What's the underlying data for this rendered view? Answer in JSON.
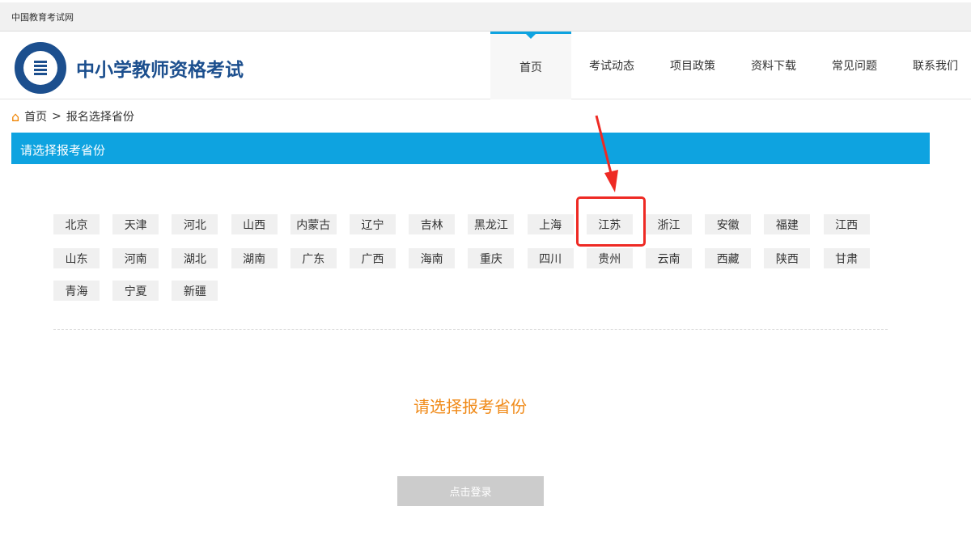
{
  "topbar": {
    "label": "中国教育考试网"
  },
  "header": {
    "title": "中小学教师资格考试",
    "nav": [
      "首页",
      "考试动态",
      "项目政策",
      "资料下载",
      "常见问题",
      "联系我们"
    ]
  },
  "breadcrumb": {
    "home": "首页",
    "sep": ">",
    "current": "报名选择省份"
  },
  "section": {
    "title": "请选择报考省份"
  },
  "provinces": [
    [
      "北京",
      "天津",
      "河北",
      "山西",
      "内蒙古",
      "辽宁",
      "吉林",
      "黑龙江",
      "上海",
      "江苏",
      "浙江",
      "安徽",
      "福建",
      "江西"
    ],
    [
      "山东",
      "河南",
      "湖北",
      "湖南",
      "广东",
      "广西",
      "海南",
      "重庆",
      "四川",
      "贵州",
      "云南",
      "西藏",
      "陕西",
      "甘肃"
    ],
    [
      "青海",
      "宁夏",
      "新疆"
    ]
  ],
  "highlighted": "江苏",
  "message": "请选择报考省份",
  "login_button": "点击登录",
  "colors": {
    "accent": "#0ea3e0",
    "highlight": "#ee2a24",
    "message": "#f08a18"
  }
}
